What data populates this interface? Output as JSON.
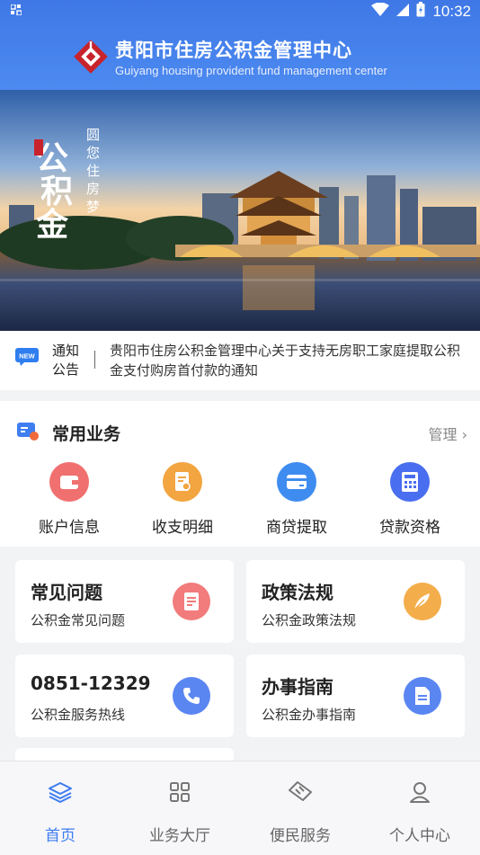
{
  "status_bar": {
    "left_icon": "qr-icon",
    "time": "10:32"
  },
  "header": {
    "title_cn": "贵阳市住房公积金管理中心",
    "title_en": "Guiyang housing provident fund management center",
    "accent": "#3f78e6"
  },
  "notice": {
    "tag_line1": "通知",
    "tag_line2": "公告",
    "text": "贵阳市住房公积金管理中心关于支持无房职工家庭提取公积金支付购房首付款的通知"
  },
  "common": {
    "title": "常用业务",
    "manage": "管理",
    "items": [
      {
        "label": "账户信息",
        "icon": "wallet-icon",
        "color": "#f06a6a"
      },
      {
        "label": "收支明细",
        "icon": "document-icon",
        "color": "#f2a540"
      },
      {
        "label": "商贷提取",
        "icon": "card-icon",
        "color": "#3f8cf0"
      },
      {
        "label": "贷款资格",
        "icon": "calculator-icon",
        "color": "#4a6ef0"
      }
    ]
  },
  "cards": [
    {
      "title": "常见问题",
      "subtitle": "公积金常见问题",
      "icon": "faq-icon",
      "color": "#f06a6a"
    },
    {
      "title": "政策法规",
      "subtitle": "公积金政策法规",
      "icon": "feather-icon",
      "color": "#f2a540"
    },
    {
      "title": "0851-12329",
      "subtitle": "公积金服务热线",
      "icon": "phone-icon",
      "color": "#4a7bf0"
    },
    {
      "title": "办事指南",
      "subtitle": "公积金办事指南",
      "icon": "guide-icon",
      "color": "#4a7bf0"
    }
  ],
  "tabs": [
    {
      "label": "首页",
      "icon": "layers-icon",
      "active": true
    },
    {
      "label": "业务大厅",
      "icon": "grid-icon",
      "active": false
    },
    {
      "label": "便民服务",
      "icon": "handshake-icon",
      "active": false
    },
    {
      "label": "个人中心",
      "icon": "person-icon",
      "active": false
    }
  ]
}
